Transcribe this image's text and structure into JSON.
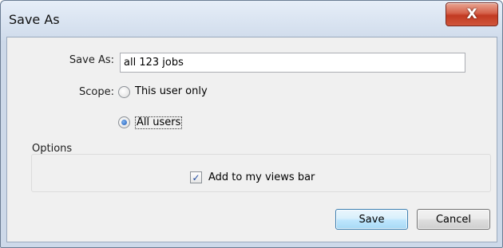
{
  "window": {
    "title": "Save As",
    "close_glyph": "X"
  },
  "form": {
    "save_as_label": "Save As:",
    "save_as_value": "all 123 jobs",
    "scope_label": "Scope:",
    "scope_options": [
      {
        "label": "This user only",
        "selected": false
      },
      {
        "label": "All users",
        "selected": true
      }
    ]
  },
  "options": {
    "group_title": "Options",
    "add_to_views_label": "Add to my views bar",
    "add_to_views_checked": true,
    "check_glyph": "✓"
  },
  "buttons": {
    "save_label": "Save",
    "cancel_label": "Cancel"
  },
  "colors": {
    "close_button": "#c23a22",
    "default_button_border": "#3c7fb1",
    "radio_selected": "#1b57b5",
    "checkmark": "#1f4aa0"
  },
  "icons": {
    "close": "close-icon",
    "check": "checkmark-icon"
  }
}
